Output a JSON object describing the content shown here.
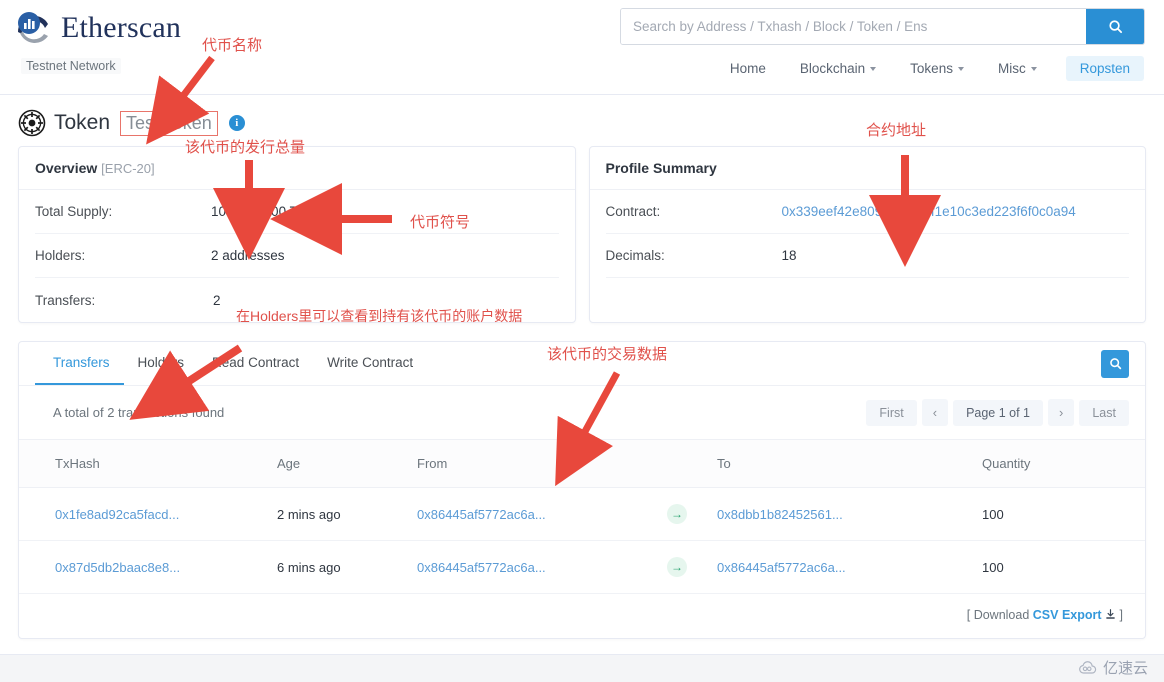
{
  "header": {
    "brand_name": "Etherscan",
    "brand_logo_icon": "etherscan-logo-icon",
    "testnet_badge": "Testnet Network",
    "search": {
      "placeholder": "Search by Address / Txhash / Block / Token / Ens",
      "value": "",
      "button_icon": "search-icon"
    },
    "nav": [
      {
        "label": "Home",
        "has_caret": false
      },
      {
        "label": "Blockchain",
        "has_caret": true
      },
      {
        "label": "Tokens",
        "has_caret": true
      },
      {
        "label": "Misc",
        "has_caret": true
      }
    ],
    "network_button": "Ropsten"
  },
  "token": {
    "icon": "token-badge-icon",
    "title": "Token",
    "name": "Test Token",
    "info_icon": "info-icon",
    "info_glyph": "i"
  },
  "overview": {
    "heading": "Overview",
    "heading_sub": "[ERC-20]",
    "rows": [
      {
        "label": "Total Supply:",
        "value": "100,000,000 TEST"
      },
      {
        "label": "Holders:",
        "value": "2 addresses"
      },
      {
        "label": "Transfers:",
        "value": "2"
      }
    ]
  },
  "profile": {
    "heading": "Profile Summary",
    "rows": [
      {
        "label": "Contract:",
        "value": "0x339eef42e809660f094f1e10c3ed223f6f0c0a94",
        "is_link": true
      },
      {
        "label": "Decimals:",
        "value": "18",
        "is_link": false
      }
    ]
  },
  "transfers_panel": {
    "tabs": [
      {
        "label": "Transfers",
        "active": true
      },
      {
        "label": "Holders",
        "active": false
      },
      {
        "label": "Read Contract",
        "active": false
      },
      {
        "label": "Write Contract",
        "active": false
      }
    ],
    "search_button_icon": "search-icon",
    "found_text": "A total of 2 transactions found",
    "pager": {
      "first": "First",
      "prev_icon": "chevron-left-icon",
      "prev_glyph": "‹",
      "page_label": "Page 1 of 1",
      "next_icon": "chevron-right-icon",
      "next_glyph": "›",
      "last": "Last"
    },
    "columns": [
      "TxHash",
      "Age",
      "From",
      "",
      "To",
      "Quantity"
    ],
    "rows": [
      {
        "txhash": "0x1fe8ad92ca5facd...",
        "age": "2 mins ago",
        "from": "0x86445af5772ac6a...",
        "arrow_glyph": "→",
        "to": "0x8dbb1b82452561...",
        "quantity": "100"
      },
      {
        "txhash": "0x87d5db2baac8e8...",
        "age": "6 mins ago",
        "from": "0x86445af5772ac6a...",
        "arrow_glyph": "→",
        "to": "0x86445af5772ac6a...",
        "quantity": "100"
      }
    ],
    "csv_prefix": "[ Download",
    "csv_link": "CSV Export",
    "csv_icon": "download-icon",
    "csv_suffix": "]"
  },
  "annotations": [
    {
      "id": "token-name",
      "text": "代币名称"
    },
    {
      "id": "total-supply",
      "text": "该代币的发行总量"
    },
    {
      "id": "token-symbol",
      "text": "代币符号"
    },
    {
      "id": "contract-address",
      "text": "合约地址"
    },
    {
      "id": "holders-hint",
      "text": "在Holders里可以查看到持有该代币的账户数据"
    },
    {
      "id": "transfer-data",
      "text": "该代币的交易数据"
    }
  ],
  "watermark": {
    "text": "亿速云",
    "icon": "cloud-icon"
  },
  "colors": {
    "brand_blue": "#21325b",
    "accent_blue": "#3498db",
    "link_blue": "#5b9bd5",
    "annotation_red": "#e0514b",
    "arrow_green": "#22a06b"
  }
}
